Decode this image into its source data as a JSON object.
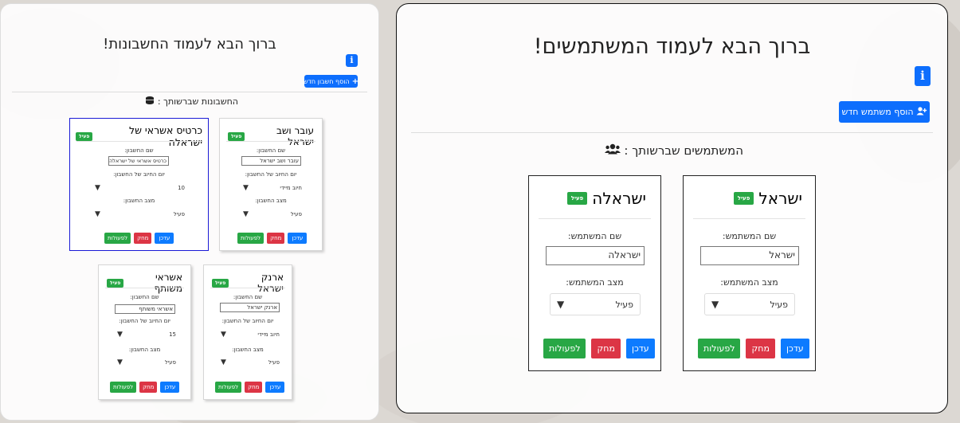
{
  "accounts_page": {
    "title": "ברוך הבא לעמוד החשבונות!",
    "info_glyph": "i",
    "add_button": "הוסף חשבון חדש",
    "section_title": "החשבונות שברשותך :",
    "labels": {
      "name": "שם החשבון:",
      "charge_day": "יום החיוב של החשבון:",
      "status": "מצב החשבון:"
    },
    "cards": [
      {
        "title": "עובר ושב ישראל",
        "badge": "פעיל",
        "name_value": "עובר ושב ישראל",
        "charge_value": "חיוב מיידי",
        "status_value": "פעיל",
        "edit": "עדכן",
        "delete": "מחק",
        "actions": "לפעולות"
      },
      {
        "title": "כרטיס אשראי של ישראלה",
        "badge": "פעיל",
        "name_value": "כרטיס אשראי של ישראלה",
        "charge_value": "10",
        "status_value": "פעיל",
        "edit": "עדכן",
        "delete": "מחק",
        "actions": "לפעולות"
      },
      {
        "title": "ארנק ישראל",
        "badge": "פעיל",
        "name_value": "ארנק ישראל",
        "charge_value": "חיוב מיידי",
        "status_value": "פעיל",
        "edit": "עדכן",
        "delete": "מחק",
        "actions": "לפעולות"
      },
      {
        "title": "אשראי משותף",
        "badge": "פעיל",
        "name_value": "אשראי משותף",
        "charge_value": "15",
        "status_value": "פעיל",
        "edit": "עדכן",
        "delete": "מחק",
        "actions": "לפעולות"
      }
    ]
  },
  "users_page": {
    "title": "ברוך הבא לעמוד המשתמשים!",
    "info_glyph": "i",
    "add_button": "הוסף משתמש חדש",
    "section_title": "המשתמשים שברשותך :",
    "labels": {
      "name": "שם המשתמש:",
      "status": "מצב המשתמש:"
    },
    "cards": [
      {
        "title": "ישראל",
        "badge": "פעיל",
        "name_value": "ישראל",
        "status_value": "פעיל",
        "edit": "עדכן",
        "delete": "מחק",
        "actions": "לפעולות"
      },
      {
        "title": "ישראלה",
        "badge": "פעיל",
        "name_value": "ישראלה",
        "status_value": "פעיל",
        "edit": "עדכן",
        "delete": "מחק",
        "actions": "לפעולות"
      }
    ]
  },
  "icons": {
    "info": "info-icon",
    "add_account": "plus-icon",
    "add_user": "user-plus-icon",
    "coins": "coins-icon",
    "users": "users-icon",
    "dropdown": "chevron-down-icon"
  },
  "colors": {
    "primary": "#0d6efd",
    "danger": "#dc3545",
    "success": "#28a745",
    "selected_border": "#1a1ad6"
  }
}
